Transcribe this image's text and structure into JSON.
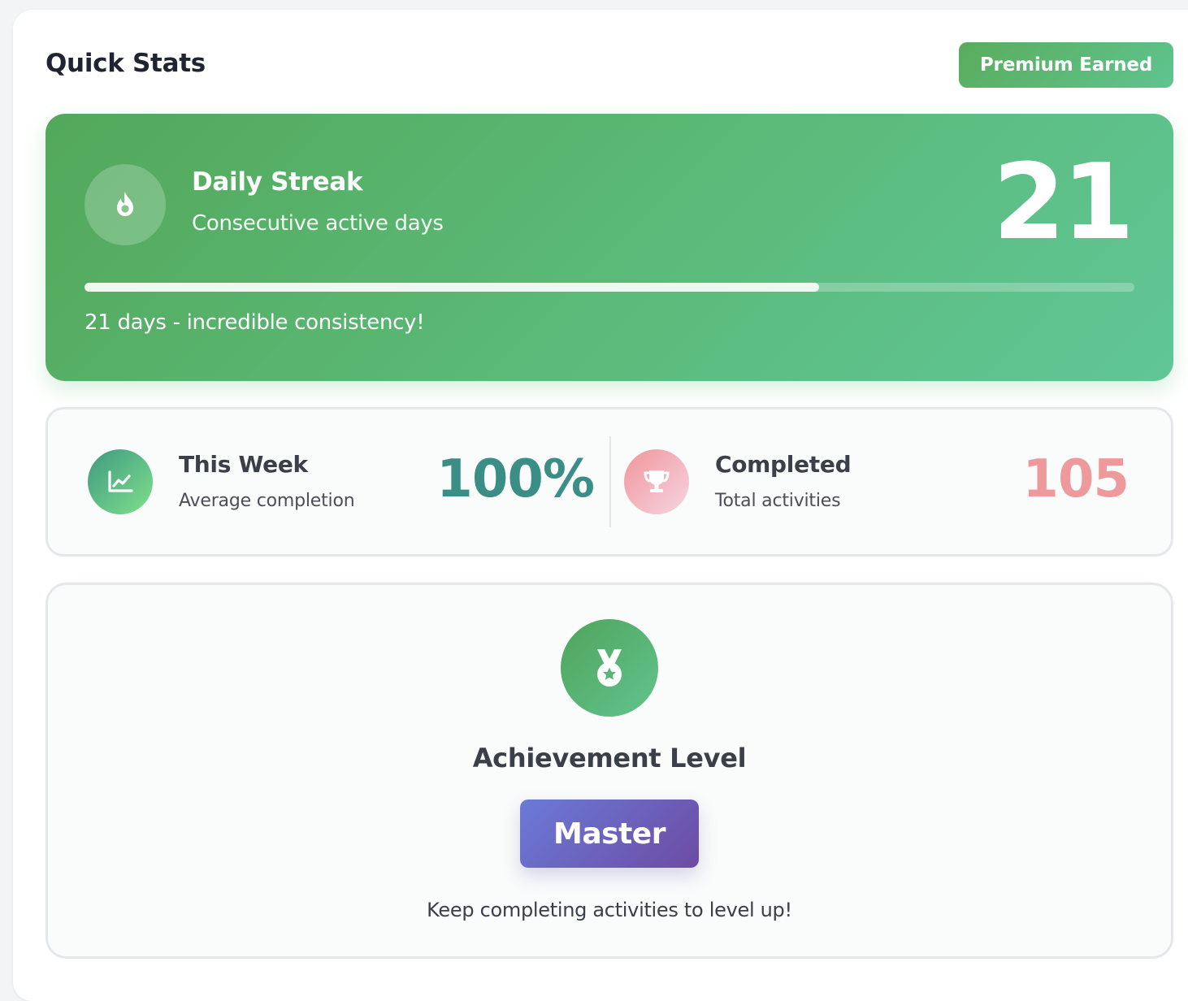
{
  "header": {
    "title": "Quick Stats",
    "badge": "Premium Earned"
  },
  "streak": {
    "icon": "flame-icon",
    "title": "Daily Streak",
    "subtitle": "Consecutive active days",
    "value": "21",
    "progress": 0.7,
    "message": "21 days - incredible consistency!"
  },
  "stats": {
    "week": {
      "icon": "chart-line-icon",
      "title": "This Week",
      "subtitle": "Average completion",
      "value": "100%",
      "color": "#3b8e86"
    },
    "completed": {
      "icon": "trophy-icon",
      "title": "Completed",
      "subtitle": "Total activities",
      "value": "105",
      "color": "#ee9a9c"
    }
  },
  "achievement": {
    "icon": "medal-icon",
    "title": "Achievement Level",
    "level": "Master",
    "message": "Keep completing activities to level up!"
  },
  "colors": {
    "accent_green": "#5aac5c",
    "level_purple": "#6d4ba3"
  }
}
